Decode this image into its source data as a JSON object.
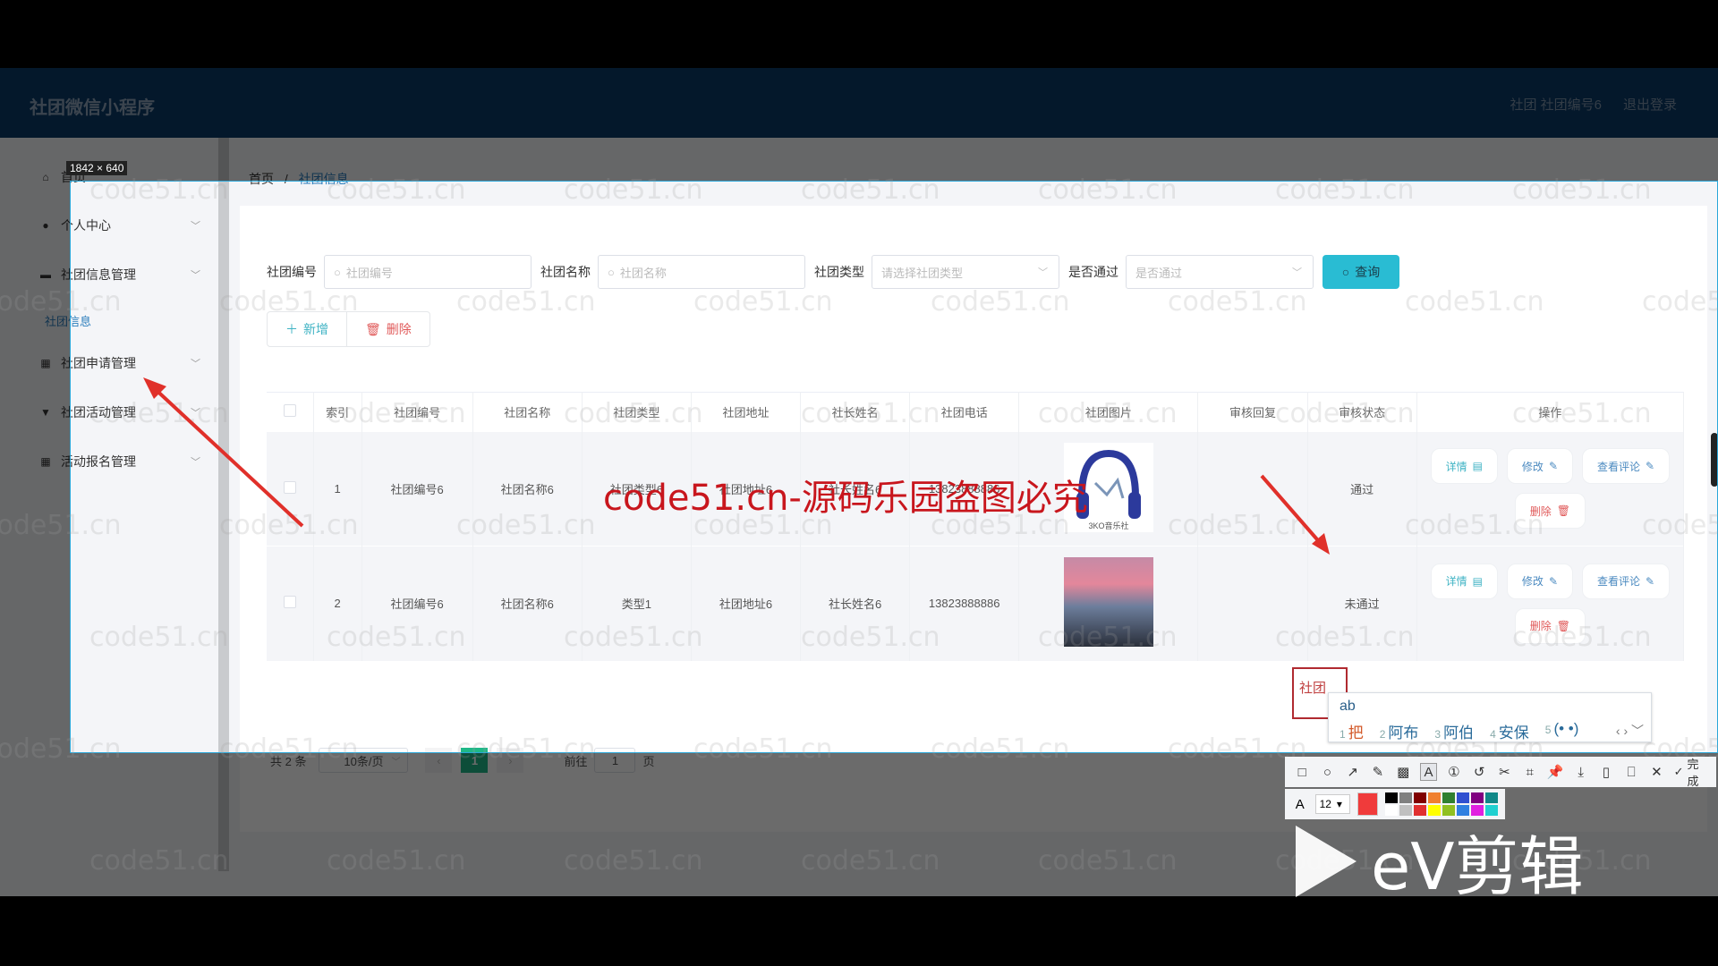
{
  "app": {
    "title": "社团微信小程序",
    "user_label": "社团 社团编号6",
    "logout_label": "退出登录"
  },
  "sidebar": {
    "items": [
      {
        "label": "首页",
        "icon": "home-icon"
      },
      {
        "label": "个人中心",
        "icon": "user-icon"
      },
      {
        "label": "社团信息管理",
        "icon": "briefcase-icon",
        "sub": [
          "社团信息"
        ]
      },
      {
        "label": "社团申请管理",
        "icon": "grid-icon"
      },
      {
        "label": "社团活动管理",
        "icon": "flag-icon"
      },
      {
        "label": "活动报名管理",
        "icon": "grid-icon"
      }
    ]
  },
  "breadcrumb": {
    "home": "首页",
    "separator": "/",
    "current": "社团信息"
  },
  "search": {
    "fields": [
      {
        "label": "社团编号",
        "placeholder": "社团编号",
        "type": "input"
      },
      {
        "label": "社团名称",
        "placeholder": "社团名称",
        "type": "input"
      },
      {
        "label": "社团类型",
        "placeholder": "请选择社团类型",
        "type": "select"
      },
      {
        "label": "是否通过",
        "placeholder": "是否通过",
        "type": "select"
      }
    ],
    "query_label": "查询"
  },
  "actions": {
    "add_label": "新增",
    "delete_label": "删除"
  },
  "table": {
    "columns": [
      "",
      "索引",
      "社团编号",
      "社团名称",
      "社团类型",
      "社团地址",
      "社长姓名",
      "社团电话",
      "社团图片",
      "审核回复",
      "审核状态",
      "操作"
    ],
    "rows": [
      {
        "index": "1",
        "code": "社团编号6",
        "name": "社团名称6",
        "type": "社团类型6",
        "address": "社团地址6",
        "leader": "社长姓名6",
        "phone": "13823888886",
        "image": "headphones-logo",
        "image_caption": "3KO音乐社",
        "reply": "",
        "status": "通过"
      },
      {
        "index": "2",
        "code": "社团编号6",
        "name": "社团名称6",
        "type": "类型1",
        "address": "社团地址6",
        "leader": "社长姓名6",
        "phone": "13823888886",
        "image": "city-sunset-photo",
        "reply": "",
        "status": "未通过"
      }
    ],
    "row_actions": {
      "detail": "详情",
      "edit": "修改",
      "comment": "查看评论",
      "delete": "删除"
    }
  },
  "pagination": {
    "total_text": "共 2 条",
    "page_size": "10条/页",
    "current_page": "1",
    "goto_label": "前往",
    "goto_value": "1",
    "page_suffix": "页"
  },
  "overlay": {
    "selection_size": "1842 × 640",
    "watermark": "code51.cn",
    "big_watermark": "code51.cn-源码乐园盗图必究",
    "annotation_text": "社团",
    "ime": {
      "composition": "ab",
      "candidates": [
        {
          "num": "1",
          "text": "把"
        },
        {
          "num": "2",
          "text": "阿布"
        },
        {
          "num": "3",
          "text": "阿伯"
        },
        {
          "num": "4",
          "text": "安保"
        },
        {
          "num": "5",
          "text": "(• •)"
        }
      ]
    },
    "toolbar": {
      "done_label": "完成",
      "font_size": "12",
      "current_color": "#f03b3b",
      "palette": [
        "#000000",
        "#808080",
        "#800000",
        "#f08030",
        "#308030",
        "#3050d0",
        "#800080",
        "#108888",
        "#ffffff",
        "#c0c0c0",
        "#e03030",
        "#ffff00",
        "#90c020",
        "#3080e0",
        "#e020e0",
        "#20d0d0"
      ]
    },
    "brand": "eV剪辑"
  }
}
